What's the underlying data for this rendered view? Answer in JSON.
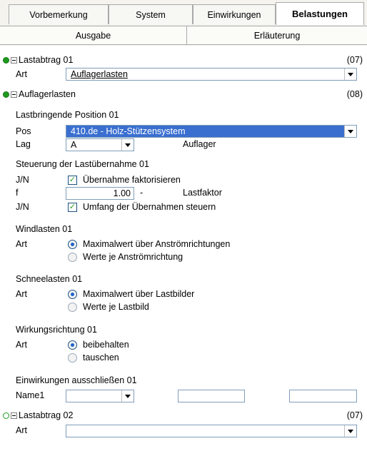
{
  "tabs_top": [
    {
      "label": "Vorbemerkung",
      "active": false
    },
    {
      "label": "System",
      "active": false
    },
    {
      "label": "Einwirkungen",
      "active": false
    },
    {
      "label": "Belastungen",
      "active": true
    }
  ],
  "tabs_sub": [
    {
      "label": "Ausgabe"
    },
    {
      "label": "Erläuterung"
    }
  ],
  "lastabtrag01": {
    "title": "Lastabtrag 01",
    "number": "(07)",
    "art_label": "Art",
    "art_value": "Auflagerlasten"
  },
  "auflagerlasten": {
    "title": "Auflagerlasten",
    "number": "(08)",
    "position": {
      "heading": "Lastbringende Position 01",
      "pos_label": "Pos",
      "pos_value": "410.de - Holz-Stützensystem",
      "lag_label": "Lag",
      "lag_value": "A",
      "lag_desc": "Auflager"
    },
    "steuerung": {
      "heading": "Steuerung der Lastübernahme 01",
      "jn1_label": "J/N",
      "jn1_text": "Übernahme faktorisieren",
      "f_label": "f",
      "f_value": "1.00",
      "f_unit": "-",
      "f_desc": "Lastfaktor",
      "jn2_label": "J/N",
      "jn2_text": "Umfang der Übernahmen steuern",
      "check_mark": "✓"
    },
    "wind": {
      "heading": "Windlasten 01",
      "art_label": "Art",
      "opt1": "Maximalwert über Anströmrichtungen",
      "opt2": "Werte je Anströmrichtung"
    },
    "schnee": {
      "heading": "Schneelasten 01",
      "art_label": "Art",
      "opt1": "Maximalwert über Lastbilder",
      "opt2": "Werte je Lastbild"
    },
    "richtung": {
      "heading": "Wirkungsrichtung 01",
      "art_label": "Art",
      "opt1": "beibehalten",
      "opt2": "tauschen"
    },
    "ausschliessen": {
      "heading": "Einwirkungen ausschließen 01",
      "name_label": "Name1"
    }
  },
  "lastabtrag02": {
    "title": "Lastabtrag 02",
    "number": "(07)",
    "art_label": "Art",
    "art_value": ""
  }
}
